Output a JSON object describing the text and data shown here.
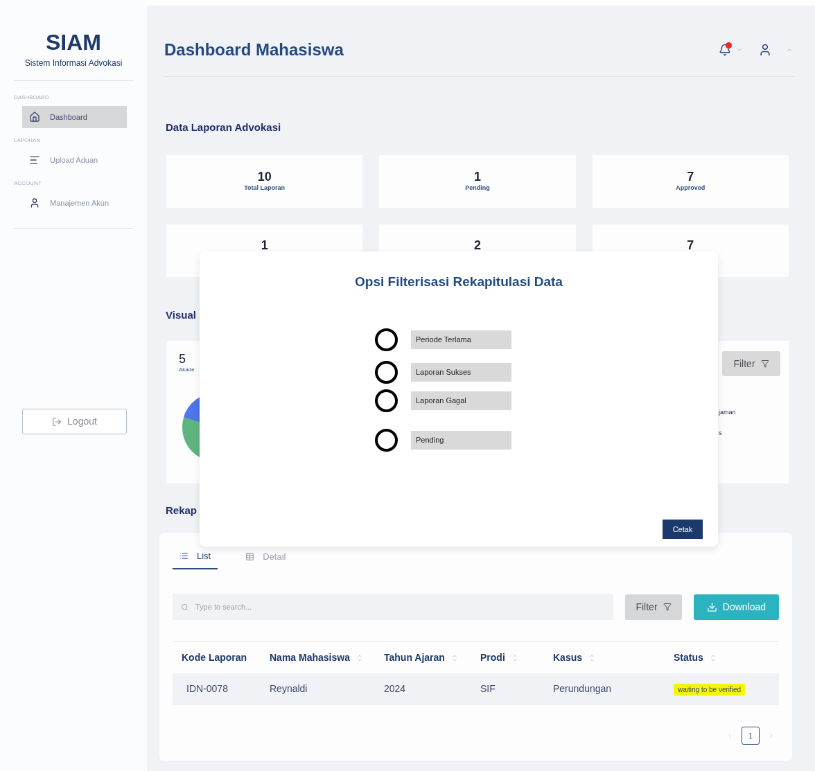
{
  "sidebar": {
    "logo": "SIAM",
    "subtitle": "Sistem Informasi Advokasi",
    "sections": [
      {
        "label": "DASHBOARD",
        "items": [
          {
            "label": "Dashboard",
            "selected": true
          }
        ]
      },
      {
        "label": "LAPORAN",
        "items": [
          {
            "label": "Upload Aduan",
            "selected": false
          }
        ]
      },
      {
        "label": "ACCOUNT",
        "items": [
          {
            "label": "Manajemen Akun",
            "selected": false
          }
        ]
      }
    ],
    "logout": "Logout"
  },
  "header": {
    "title": "Dashboard Mahasiswa"
  },
  "summary": {
    "title": "Data Laporan Advokasi",
    "cards": [
      {
        "value": "10",
        "label": "Total Laporan"
      },
      {
        "value": "1",
        "label": "Pending"
      },
      {
        "value": "7",
        "label": "Approved"
      }
    ],
    "cards_row2": [
      {
        "value": "1"
      },
      {
        "value": "2"
      },
      {
        "value": "7"
      }
    ]
  },
  "visual": {
    "title": "Visual",
    "value": "5",
    "label": "Akade",
    "filter": "Filter",
    "legend": [
      "jaman",
      "s"
    ]
  },
  "rekap": {
    "title": "Rekap",
    "tabs": [
      {
        "label": "List",
        "selected": true
      },
      {
        "label": "Detail",
        "selected": false
      }
    ],
    "search": {
      "placeholder": "Type to search..."
    },
    "filter": "Filter",
    "download": "Download",
    "columns": [
      "Kode Laporan",
      "Nama Mahasiswa",
      "Tahun Ajaran",
      "Prodi",
      "Kasus",
      "Status"
    ],
    "rows": [
      {
        "cells": [
          "IDN-0078",
          "Reynaldi",
          "2024",
          "SIF",
          "Perundungan"
        ],
        "status": "waiting to be verified"
      }
    ],
    "pages": [
      {
        "label": "1",
        "selected": true
      }
    ]
  },
  "modal": {
    "title": "Opsi Filterisasi Rekapitulasi Data",
    "options": [
      {
        "label": "Periode Terlama",
        "selected": false
      },
      {
        "label": "Laporan Sukses",
        "selected": false
      },
      {
        "label": "Laporan Gagal",
        "selected": false
      },
      {
        "label": "Pending",
        "selected": false
      }
    ],
    "button": "Cetak"
  }
}
